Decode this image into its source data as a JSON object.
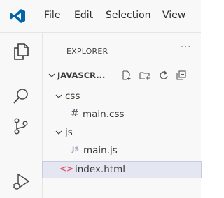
{
  "menu": {
    "items": [
      "File",
      "Edit",
      "Selection",
      "View"
    ]
  },
  "activity_bar": {
    "icons": [
      "explorer-icon",
      "search-icon",
      "source-control-icon",
      "run-debug-icon"
    ]
  },
  "explorer": {
    "title": "EXPLORER",
    "more_label": "···",
    "section_title": "JAVASCR...",
    "toolbar_icons": [
      "new-file-icon",
      "new-folder-icon",
      "refresh-icon",
      "collapse-all-icon"
    ],
    "tree": {
      "css_folder": "css",
      "main_css": "main.css",
      "js_folder": "js",
      "main_js": "main.js",
      "index_html": "index.html"
    },
    "file_badges": {
      "css": "#",
      "js": "JS",
      "html": "<>"
    }
  },
  "colors": {
    "accent_blue": "#0065a9",
    "selection_bg": "#e4e6f1",
    "html_icon": "#e0596a"
  }
}
